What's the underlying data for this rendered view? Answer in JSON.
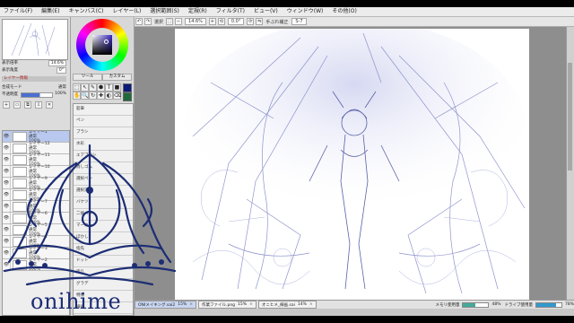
{
  "menu": [
    "ファイル(F)",
    "編集(E)",
    "キャンバス(C)",
    "レイヤー(L)",
    "選択範囲(S)",
    "定規(R)",
    "フィルタ(T)",
    "ビュー(V)",
    "ウィンドウ(W)",
    "その他(O)"
  ],
  "toolbar": {
    "selection_label": "選択",
    "zoom_value": "14.6%",
    "angle_value": "0.0°",
    "stabilizer_label": "手ぶれ補正",
    "stabilizer_value": "S-7"
  },
  "navigator": {
    "zoom_label": "表示倍率",
    "zoom_value": "14.6%",
    "angle_label": "表示角度",
    "angle_value": "0°"
  },
  "layer_props": {
    "header": "レイヤー情報",
    "blend_label": "合成モード",
    "blend_value": "通常",
    "opacity_label": "不透明度",
    "opacity_value": "100%"
  },
  "layers": [
    {
      "name": "レイヤー1",
      "mode": "通常",
      "opacity": "100%"
    },
    {
      "name": "レイヤー12",
      "mode": "通常",
      "opacity": "100%"
    },
    {
      "name": "レイヤー11",
      "mode": "通常",
      "opacity": "100%"
    },
    {
      "name": "レイヤー10",
      "mode": "通常",
      "opacity": "100%"
    },
    {
      "name": "レイヤー9",
      "mode": "通常",
      "opacity": "100%"
    },
    {
      "name": "レイヤー8",
      "mode": "通常",
      "opacity": "100%"
    },
    {
      "name": "レイヤー7",
      "mode": "通常",
      "opacity": "100%"
    },
    {
      "name": "レイヤー6",
      "mode": "通常",
      "opacity": "100%"
    },
    {
      "name": "レイヤー5",
      "mode": "通常",
      "opacity": "100%"
    },
    {
      "name": "レイヤー4",
      "mode": "通常",
      "opacity": "100%"
    },
    {
      "name": "レイヤー3",
      "mode": "通常",
      "opacity": "100%"
    },
    {
      "name": "レイヤー2",
      "mode": "通常",
      "opacity": "100%"
    }
  ],
  "tools": [
    "⬚",
    "↖",
    "✎",
    "⬢",
    "T",
    "■",
    "✋",
    "🔍",
    "↻",
    "✚",
    "◐",
    "⌫"
  ],
  "brushes": [
    "鉛筆",
    "ペン",
    "ブラシ",
    "水彩",
    "エアブラシ",
    "消しゴム",
    "選択ペン",
    "選択消し",
    "バケツ",
    "二値ペン",
    "マーカー",
    "ぼかし",
    "指先",
    "ドット",
    "塗り",
    "グラデ",
    "特殊",
    "線画",
    "影",
    "光"
  ],
  "mid_tabs": [
    "ツール",
    "カスタム"
  ],
  "files": [
    {
      "name": "ONIメイキング.sai2",
      "zoom": "15%",
      "active": true
    },
    {
      "name": "作業ファイル.png",
      "zoom": "15%",
      "active": false
    },
    {
      "name": "オニヒメ_線画.sai",
      "zoom": "14%",
      "active": false
    }
  ],
  "status": {
    "mem_label": "メモリ使用量",
    "mem_value": "48%",
    "mem_fraction": 0.48,
    "drive_label": "ドライブ使用量",
    "drive_value": "78%",
    "drive_fraction": 0.78
  },
  "watermark": {
    "brand": "onihime"
  },
  "colors": {
    "accent": "#1c2d74",
    "line_art": "#6a72b8",
    "selection": "#b8c8ee"
  }
}
